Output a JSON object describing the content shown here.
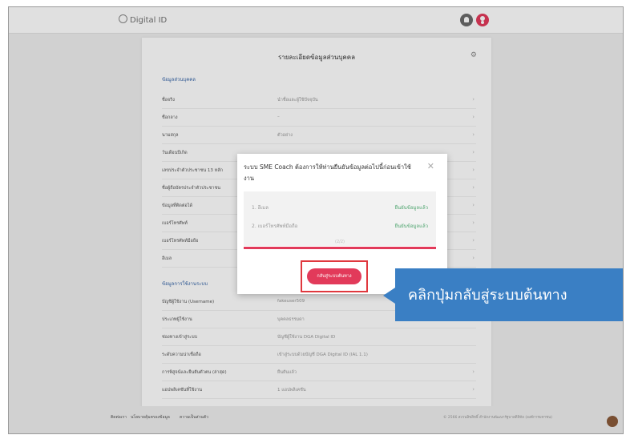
{
  "app": {
    "title": "Digital ID"
  },
  "card": {
    "title": "รายละเอียดข้อมูลส่วนบุคคล",
    "gear_icon": "gear-icon"
  },
  "personal": {
    "heading": "ข้อมูลส่วนบุคคล",
    "rows": [
      {
        "label": "ชื่อจริง",
        "value": "นำชื่อและผู้ใช้ปัจจุบัน"
      },
      {
        "label": "ชื่อกลาง",
        "value": "–"
      },
      {
        "label": "นามสกุล",
        "value": "ตัวอย่าง"
      },
      {
        "label": "วันเดือนปีเกิด",
        "value": ""
      },
      {
        "label": "เลขประจำตัวประชาชน 13 หลัก",
        "value": ""
      },
      {
        "label": "ชื่อผู้ถือบัตรประจำตัวประชาชน",
        "value": ""
      },
      {
        "label": "ข้อมูลที่ติดต่อได้",
        "value": ""
      },
      {
        "label": "เบอร์โทรศัพท์",
        "value": ""
      },
      {
        "label": "เบอร์โทรศัพท์มือถือ",
        "value": ""
      },
      {
        "label": "อีเมล",
        "value": ""
      }
    ]
  },
  "usage": {
    "heading": "ข้อมูลการใช้งานระบบ",
    "rows": [
      {
        "label": "บัญชีผู้ใช้งาน (Username)",
        "value": "fakeuser509"
      },
      {
        "label": "ประเภทผู้ใช้งาน",
        "value": "บุคคลธรรมดา"
      },
      {
        "label": "ช่องทางเข้าสู่ระบบ",
        "value": "บัญชีผู้ใช้งาน DGA Digital ID"
      },
      {
        "label": "ระดับความน่าเชื่อถือ",
        "value": "เข้าสู่ระบบด้วยบัญชี DGA Digital ID (IAL 1.1)"
      },
      {
        "label": "การพิสูจน์และยืนยันตัวตน (ล่าสุด)",
        "value": "ยืนยันแล้ว"
      },
      {
        "label": "แอปพลิเคชันที่ใช้งาน",
        "value": "1 แอปพลิเคชัน"
      }
    ]
  },
  "modal": {
    "title": "ระบบ SME Coach ต้องการให้ท่านยืนยันข้อมูลต่อไปนี้ก่อนเข้าใช้งาน",
    "items": [
      {
        "label": "1. อีเมล",
        "status": "ยืนยันข้อมูลแล้ว"
      },
      {
        "label": "2. เบอร์โทรศัพท์มือถือ",
        "status": "ยืนยันข้อมูลแล้ว"
      }
    ],
    "count": "(2/2)",
    "button": "กลับสู่ระบบต้นทาง"
  },
  "callout": {
    "text": "คลิกปุ่มกลับสู่ระบบต้นทาง"
  },
  "footer": {
    "links": [
      "ติดต่อเรา",
      "นโยบายคุ้มครองข้อมูล",
      "ความเป็นส่วนตัว"
    ],
    "copyright": "© 2566 สงวนลิขสิทธิ์ สำนักงานพัฒนารัฐบาลดิจิทัล (องค์การมหาชน)"
  },
  "colors": {
    "accent": "#e23a5a",
    "callout": "#3a7fc4",
    "success": "#4fa56f",
    "section": "#3866a8"
  }
}
